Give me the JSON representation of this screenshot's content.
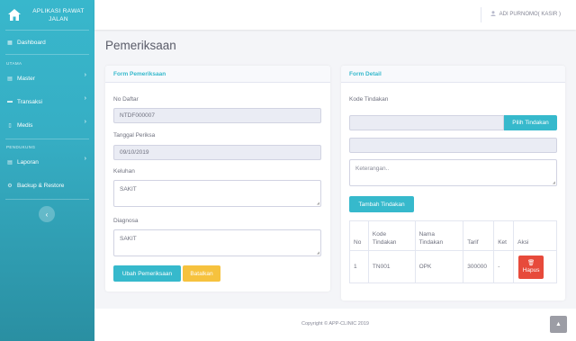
{
  "sidebar": {
    "brand": "APLIKASI RAWAT JALAN",
    "dashboard": "Dashboard",
    "heading_utama": "UTAMA",
    "master": "Master",
    "transaksi": "Transaksi",
    "medis": "Medis",
    "heading_pendukung": "PENDUKUNG",
    "laporan": "Laporan",
    "backup": "Backup & Restore",
    "toggle_glyph": "‹",
    "accent": "#36b9cc"
  },
  "topbar": {
    "user": "ADI PURNOMO( KASIR )"
  },
  "page": {
    "title": "Pemeriksaan"
  },
  "form_pemeriksaan": {
    "header": "Form Pemeriksaan",
    "no_daftar_label": "No Daftar",
    "no_daftar_value": "NTDF000007",
    "tanggal_label": "Tanggal Periksa",
    "tanggal_value": "09/10/2019",
    "keluhan_label": "Keluhan",
    "keluhan_value": "SAKIT",
    "diagnosa_label": "Diagnosa",
    "diagnosa_value": "SAKIT",
    "ubah_button": "Ubah Pemeriksaan",
    "batalkan_button": "Batalkan"
  },
  "form_detail": {
    "header": "Form Detail",
    "kode_label": "Kode Tindakan",
    "pilih_button": "Pilih Tindakan",
    "keterangan_placeholder": "Keterangan..",
    "tambah_button": "Tambah Tindakan",
    "table": {
      "headers": [
        "No",
        "Kode Tindakan",
        "Nama Tindakan",
        "Tarif",
        "Ket",
        "Aksi"
      ],
      "rows": [
        {
          "no": "1",
          "kode": "TN001",
          "nama": "OPK",
          "tarif": "300000",
          "ket": "-",
          "aksi": "Hapus"
        }
      ]
    }
  },
  "footer": {
    "copyright": "Copyright © APP-CLINIC 2019"
  }
}
